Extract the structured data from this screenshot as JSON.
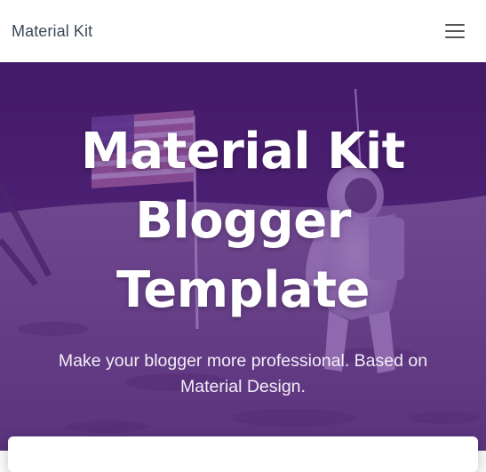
{
  "navbar": {
    "brand": "Material Kit"
  },
  "hero": {
    "title": "Material Kit Blogger Template",
    "subtitle": "Make your blogger more professional. Based on Material Design."
  },
  "colors": {
    "overlay": "#5a1e8c",
    "nav_bg": "#ffffff",
    "brand_text": "#3c4858"
  }
}
